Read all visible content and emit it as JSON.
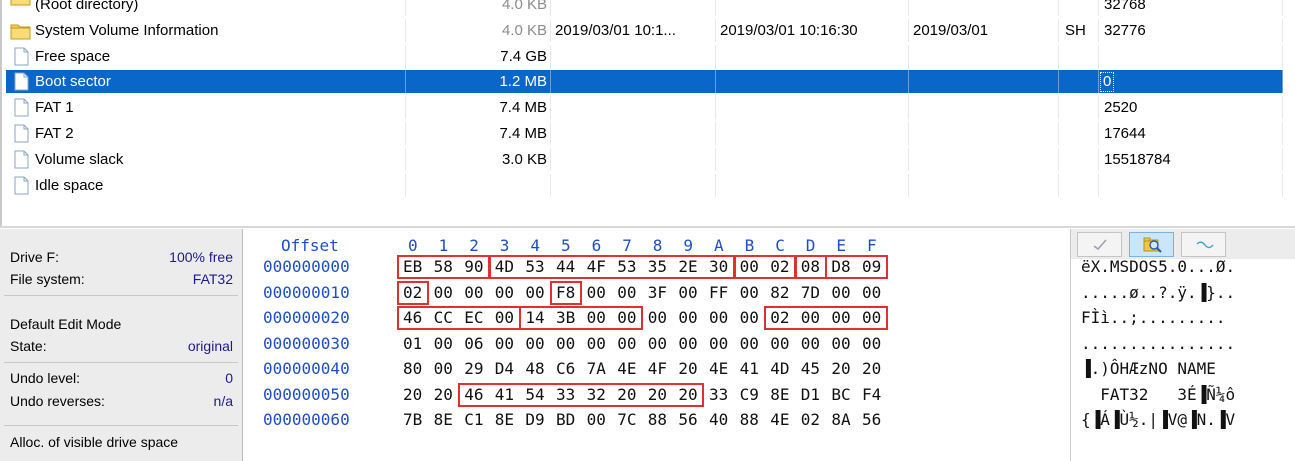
{
  "file_list": {
    "rows": [
      {
        "name": "(Root directory)",
        "size": "4.0 KB",
        "created": "",
        "modified": "",
        "accessed": "",
        "attr": "",
        "first_sector": "32768",
        "icon": "folder-icon",
        "size_dark": false
      },
      {
        "name": "System Volume Information",
        "size": "4.0 KB",
        "created": "2019/03/01  10:1...",
        "modified": "2019/03/01  10:16:30",
        "accessed": "2019/03/01",
        "attr": "SH",
        "first_sector": "32776",
        "icon": "folder-icon",
        "size_dark": false
      },
      {
        "name": "Free space",
        "size": "7.4 GB",
        "created": "",
        "modified": "",
        "accessed": "",
        "attr": "",
        "first_sector": "",
        "icon": "file-icon",
        "size_dark": true
      },
      {
        "name": "Boot sector",
        "size": "1.2 MB",
        "created": "",
        "modified": "",
        "accessed": "",
        "attr": "",
        "first_sector": "0",
        "icon": "file-icon",
        "size_dark": true,
        "selected": true
      },
      {
        "name": "FAT 1",
        "size": "7.4 MB",
        "created": "",
        "modified": "",
        "accessed": "",
        "attr": "",
        "first_sector": "2520",
        "icon": "file-icon",
        "size_dark": true
      },
      {
        "name": "FAT 2",
        "size": "7.4 MB",
        "created": "",
        "modified": "",
        "accessed": "",
        "attr": "",
        "first_sector": "17644",
        "icon": "file-icon",
        "size_dark": true
      },
      {
        "name": "Volume slack",
        "size": "3.0 KB",
        "created": "",
        "modified": "",
        "accessed": "",
        "attr": "",
        "first_sector": "15518784",
        "icon": "file-icon",
        "size_dark": true
      },
      {
        "name": "Idle space",
        "size": "",
        "created": "",
        "modified": "",
        "accessed": "",
        "attr": "",
        "first_sector": "",
        "icon": "file-icon",
        "size_dark": true
      }
    ]
  },
  "info_panel": {
    "drive_label": "Drive F:",
    "drive_free": "100% free",
    "fs_label": "File system:",
    "fs_value": "FAT32",
    "edit_mode_label": "Default Edit Mode",
    "state_label": "State:",
    "state_value": "original",
    "undo_level_label": "Undo level:",
    "undo_level_value": "0",
    "undo_reverses_label": "Undo reverses:",
    "undo_reverses_value": "n/a",
    "alloc_label": "Alloc. of visible drive space"
  },
  "hex_view": {
    "offset_header": "Offset",
    "column_headers": [
      "0",
      "1",
      "2",
      "3",
      "4",
      "5",
      "6",
      "7",
      "8",
      "9",
      "A",
      "B",
      "C",
      "D",
      "E",
      "F"
    ],
    "rows": [
      {
        "offset": "000000000",
        "bytes": [
          "EB",
          "58",
          "90",
          "4D",
          "53",
          "44",
          "4F",
          "53",
          "35",
          "2E",
          "30",
          "00",
          "02",
          "08",
          "D8",
          "09"
        ],
        "text": "ëX.MSDOS5.0...Ø."
      },
      {
        "offset": "000000010",
        "bytes": [
          "02",
          "00",
          "00",
          "00",
          "00",
          "F8",
          "00",
          "00",
          "3F",
          "00",
          "FF",
          "00",
          "82",
          "7D",
          "00",
          "00"
        ],
        "text": ".....ø..?.ÿ.▐}.."
      },
      {
        "offset": "000000020",
        "bytes": [
          "46",
          "CC",
          "EC",
          "00",
          "14",
          "3B",
          "00",
          "00",
          "00",
          "00",
          "00",
          "00",
          "02",
          "00",
          "00",
          "00"
        ],
        "text": "FÌì..;........."
      },
      {
        "offset": "000000030",
        "bytes": [
          "01",
          "00",
          "06",
          "00",
          "00",
          "00",
          "00",
          "00",
          "00",
          "00",
          "00",
          "00",
          "00",
          "00",
          "00",
          "00"
        ],
        "text": "................"
      },
      {
        "offset": "000000040",
        "bytes": [
          "80",
          "00",
          "29",
          "D4",
          "48",
          "C6",
          "7A",
          "4E",
          "4F",
          "20",
          "4E",
          "41",
          "4D",
          "45",
          "20",
          "20"
        ],
        "text": "▐.)ÔHÆzNO NAME  "
      },
      {
        "offset": "000000050",
        "bytes": [
          "20",
          "20",
          "46",
          "41",
          "54",
          "33",
          "32",
          "20",
          "20",
          "20",
          "33",
          "C9",
          "8E",
          "D1",
          "BC",
          "F4"
        ],
        "text": "  FAT32   3É▐Ñ¼ô"
      },
      {
        "offset": "000000060",
        "bytes": [
          "7B",
          "8E",
          "C1",
          "8E",
          "D9",
          "BD",
          "00",
          "7C",
          "88",
          "56",
          "40",
          "88",
          "4E",
          "02",
          "8A",
          "56"
        ],
        "text": "{▐Á▐Ù½.|▐V@▐N.▐V"
      }
    ]
  },
  "toolbar": {
    "buttons": [
      {
        "icon": "check-icon",
        "active": false
      },
      {
        "icon": "search-folder-icon",
        "active": true
      },
      {
        "icon": "wave-icon",
        "active": false
      }
    ]
  }
}
